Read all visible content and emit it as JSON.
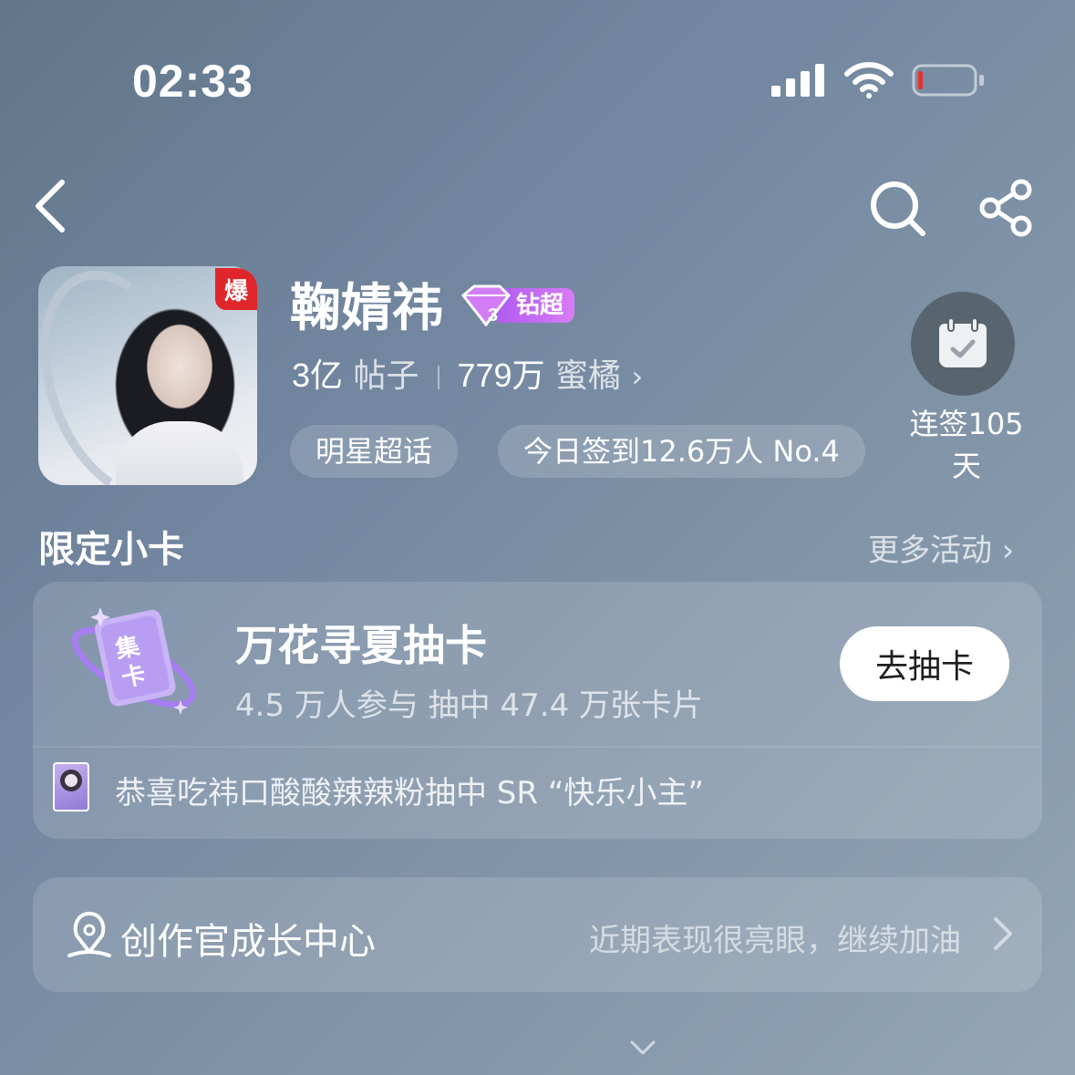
{
  "status_bar": {
    "time": "02:33"
  },
  "profile": {
    "name": "鞠婧祎",
    "hot_badge": "爆",
    "vip_label": "钻超",
    "vip_level": "3",
    "posts_count": "3亿",
    "posts_unit": "帖子",
    "fans_count": "779万",
    "fans_unit": "蜜橘",
    "category_tag": "明星超话",
    "checkin_rank": "今日签到12.6万人 No.4",
    "streak_line1": "连签105",
    "streak_line2": "天"
  },
  "section": {
    "title": "限定小卡",
    "more_label": "更多活动 ›"
  },
  "card": {
    "deco_line1": "集",
    "deco_line2": "卡",
    "title": "万花寻夏抽卡",
    "subtitle": "4.5 万人参与  抽中 47.4 万张卡片",
    "button": "去抽卡",
    "notice": "恭喜吃祎口酸酸辣辣粉抽中 SR “快乐小主”"
  },
  "creator": {
    "title": "创作官成长中心",
    "tip": "近期表现很亮眼，继续加油"
  },
  "colors": {
    "accent_purple": "#b15cf0",
    "hot_red": "#e0262a",
    "battery_low": "#e5322d"
  },
  "icons": [
    "back-icon",
    "search-icon",
    "share-icon",
    "calendar-check-icon",
    "chevron-right-icon",
    "chevron-down-icon",
    "signal-icon",
    "wifi-icon",
    "battery-icon",
    "creator-pen-icon",
    "diamond-icon"
  ]
}
